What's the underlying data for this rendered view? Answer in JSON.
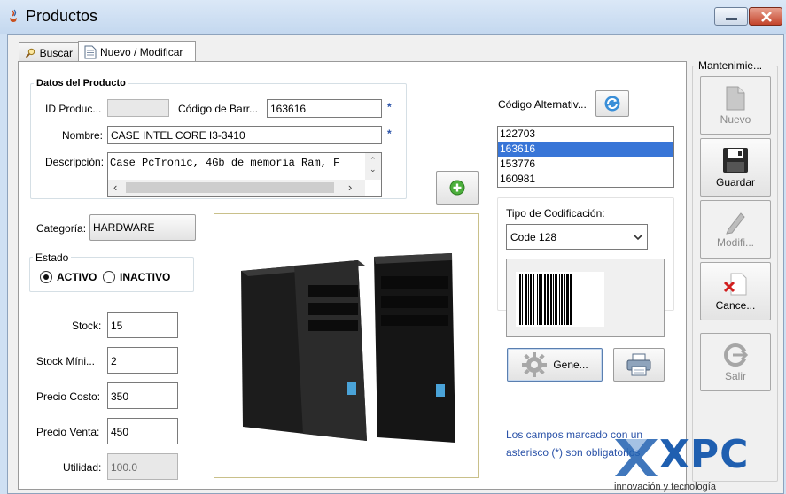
{
  "window": {
    "title": "Productos"
  },
  "tabs": [
    {
      "label": "Buscar",
      "icon": "search-icon"
    },
    {
      "label": "Nuevo / Modificar",
      "icon": "document-icon"
    }
  ],
  "datos": {
    "legend": "Datos del Producto",
    "id_label": "ID Produc...",
    "id_value": "",
    "barcode_label": "Código de Barr...",
    "barcode_value": "163616",
    "nombre_label": "Nombre:",
    "nombre_value": "CASE INTEL CORE I3-3410",
    "descripcion_label": "Descripción:",
    "descripcion_value": "Case PcTronic, 4Gb de memoria Ram, F",
    "required_mark": "*"
  },
  "categoria": {
    "label": "Categoría:",
    "value": "HARDWARE"
  },
  "estado": {
    "legend": "Estado",
    "activo": "ACTIVO",
    "inactivo": "INACTIVO",
    "selected": "ACTIVO"
  },
  "fields": {
    "stock_label": "Stock:",
    "stock_value": "15",
    "stock_min_label": "Stock Míni...",
    "stock_min_value": "2",
    "precio_costo_label": "Precio Costo:",
    "precio_costo_value": "350",
    "precio_venta_label": "Precio Venta:",
    "precio_venta_value": "450",
    "utilidad_label": "Utilidad:",
    "utilidad_value": "100.0"
  },
  "codigos": {
    "label": "Código Alternativ...",
    "items": [
      "122703",
      "163616",
      "153776",
      "160981"
    ],
    "selected": "163616"
  },
  "codificacion": {
    "label": "Tipo de Codificación:",
    "value": "Code 128"
  },
  "generate_button": "Gene...",
  "note": "Los campos marcado con un asterisco (*) son obligatorios",
  "mantenimiento": {
    "legend": "Mantenimie...",
    "nuevo": "Nuevo",
    "guardar": "Guardar",
    "modificar": "Modifi...",
    "cancelar": "Cance...",
    "salir": "Salir"
  },
  "watermark": {
    "brand": "XPC",
    "tagline": "innovación y tecnología"
  },
  "colors": {
    "selection": "#3875d7",
    "note_text": "#2a52a8",
    "brand_blue": "#1f5fb0"
  }
}
